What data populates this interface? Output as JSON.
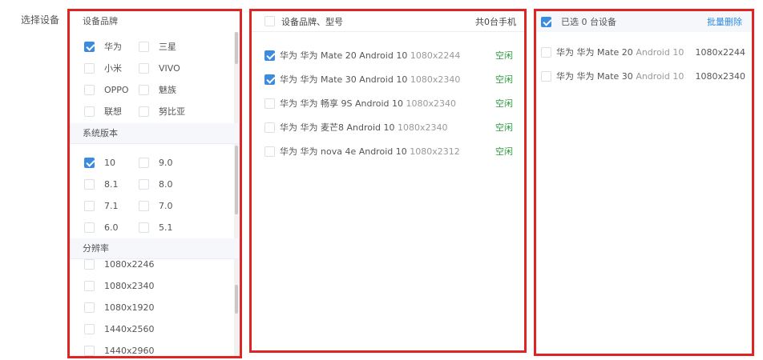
{
  "form": {
    "label": "选择设备"
  },
  "brand_section": {
    "title": "设备品牌",
    "options": [
      {
        "label": "华为",
        "checked": true
      },
      {
        "label": "三星",
        "checked": false
      },
      {
        "label": "小米",
        "checked": false
      },
      {
        "label": "VIVO",
        "checked": false
      },
      {
        "label": "OPPO",
        "checked": false
      },
      {
        "label": "魅族",
        "checked": false
      },
      {
        "label": "联想",
        "checked": false
      },
      {
        "label": "努比亚",
        "checked": false
      }
    ]
  },
  "version_section": {
    "title": "系统版本",
    "options": [
      {
        "label": "10",
        "checked": true
      },
      {
        "label": "9.0",
        "checked": false
      },
      {
        "label": "8.1",
        "checked": false
      },
      {
        "label": "8.0",
        "checked": false
      },
      {
        "label": "7.1",
        "checked": false
      },
      {
        "label": "7.0",
        "checked": false
      },
      {
        "label": "6.0",
        "checked": false
      },
      {
        "label": "5.1",
        "checked": false
      }
    ]
  },
  "resolution_section": {
    "title": "分辨率",
    "options": [
      {
        "label": "1080x2246",
        "checked": false
      },
      {
        "label": "1080x2340",
        "checked": false
      },
      {
        "label": "1080x1920",
        "checked": false
      },
      {
        "label": "1440x2560",
        "checked": false
      },
      {
        "label": "1440x2960",
        "checked": false
      }
    ]
  },
  "device_list": {
    "header_title": "设备品牌、型号",
    "count_label": "共0台手机",
    "devices": [
      {
        "name": "华为 华为 Mate 20 Android 10",
        "resolution": "1080x2244",
        "status": "空闲",
        "checked": true
      },
      {
        "name": "华为 华为 Mate 30 Android 10",
        "resolution": "1080x2340",
        "status": "空闲",
        "checked": true
      },
      {
        "name": "华为 华为 畅享 9S Android 10",
        "resolution": "1080x2340",
        "status": "空闲",
        "checked": false
      },
      {
        "name": "华为 华为 麦芒8 Android 10",
        "resolution": "1080x2340",
        "status": "空闲",
        "checked": false
      },
      {
        "name": "华为 华为 nova 4e Android 10",
        "resolution": "1080x2312",
        "status": "空闲",
        "checked": false
      }
    ]
  },
  "selected": {
    "header_title": "已选 0 台设备",
    "batch_delete": "批量删除",
    "devices": [
      {
        "name": "华为 华为 Mate 20",
        "os": "Android 10",
        "resolution": "1080x2244"
      },
      {
        "name": "华为 华为 Mate 30",
        "os": "Android 10",
        "resolution": "1080x2340"
      }
    ]
  },
  "colors": {
    "accent": "#3b8ce0",
    "status_idle": "#2e9a40",
    "highlight_border": "#e02424"
  }
}
